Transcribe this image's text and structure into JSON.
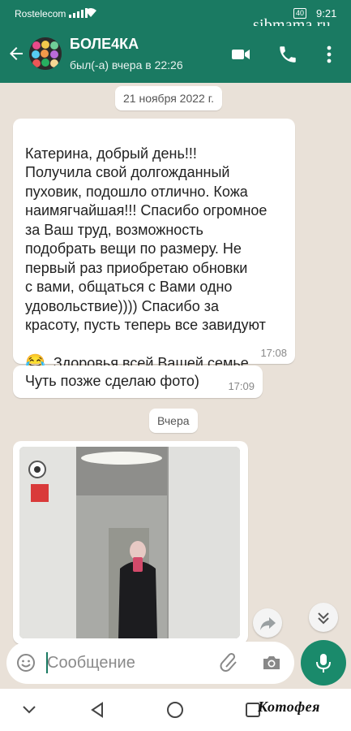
{
  "status_bar": {
    "carrier": "Rostelecom",
    "battery": "40",
    "time": "9:21"
  },
  "watermark": "sibmama.ru",
  "header": {
    "contact_name": "БОЛЕ4КА",
    "last_seen": "был(-а) вчера в 22:26"
  },
  "chat": {
    "date_chip_1": "21 ноября 2022 г.",
    "message_1": {
      "text_a": "Катерина, добрый день!!!\nПолучила свой долгожданный\nпуховик, подошло отлично. Кожа\nнаимягчайшая!!! Спасибо огромное\nза Ваш труд, возможность\nподобрать вещи по размеру. Не\nпервый раз приобретаю обновки\nс вами, общаться с Вами одно\nудовольствие)))) Спасибо за\nкрасоту, пусть теперь все завидуют",
      "emoji": "😂",
      "text_b": ". Здоровья всей Вашей семье ,\nнаилучших пожеланий!!!!!!",
      "time": "17:08"
    },
    "message_2": {
      "text": "Чуть позже сделаю фото)",
      "time": "17:09"
    },
    "date_chip_2": "Вчера"
  },
  "composer": {
    "placeholder": "Сообщение"
  },
  "brand": "Котофея",
  "icons": [
    "back-arrow-icon",
    "video-call-icon",
    "phone-icon",
    "more-vert-icon",
    "forward-icon",
    "scroll-down-icon",
    "emoji-icon",
    "attach-icon",
    "camera-icon",
    "mic-icon"
  ],
  "colors": {
    "header": "#1a7a62",
    "chat_bg": "#e9e1d8",
    "mic": "#1a8a6b"
  }
}
